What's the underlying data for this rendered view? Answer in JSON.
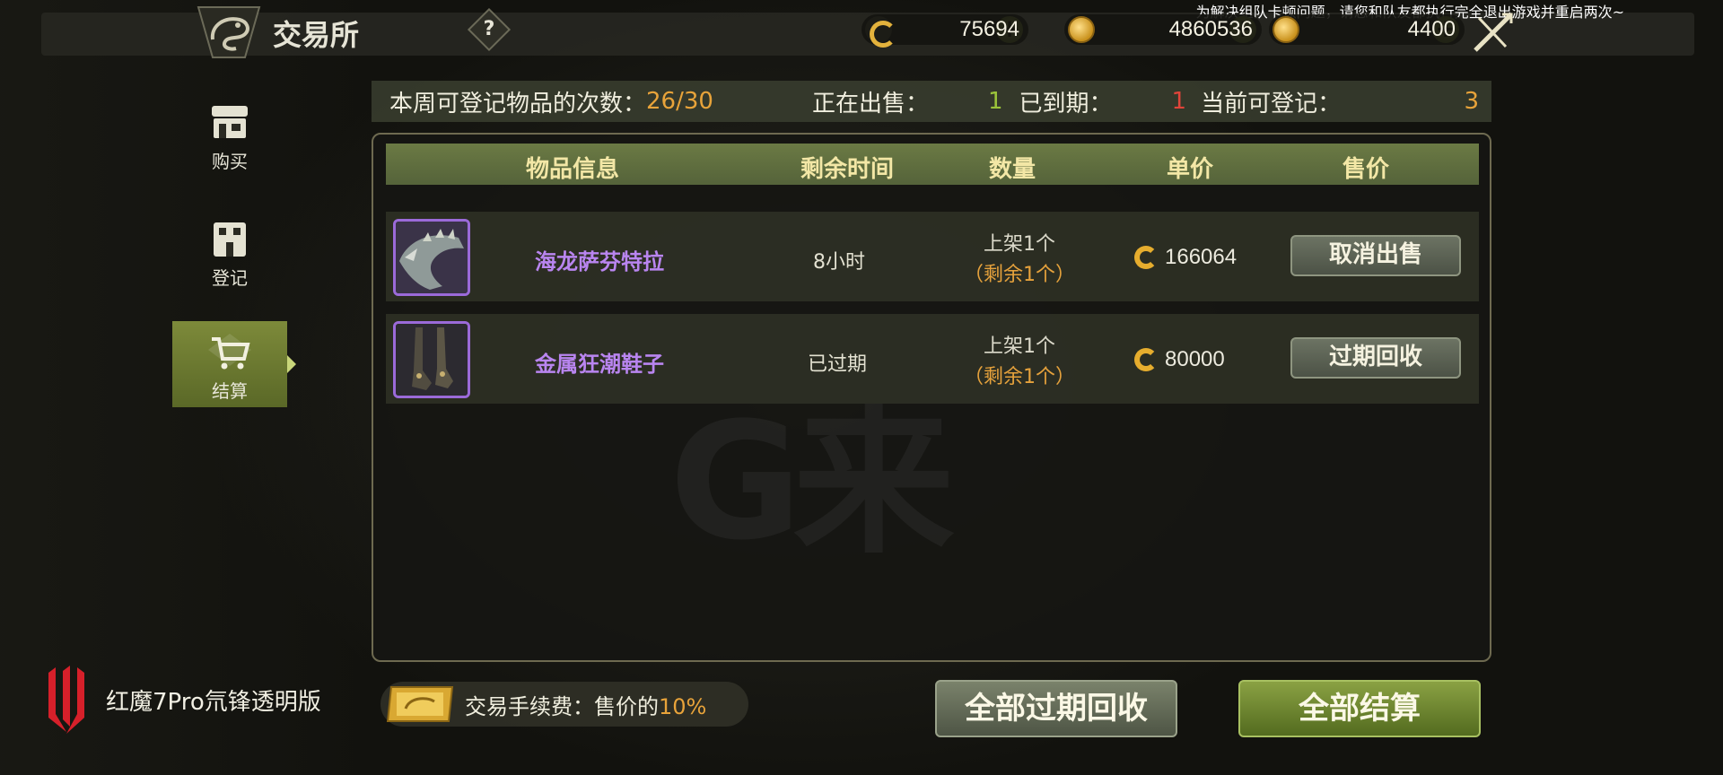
{
  "notice": "为解决组队卡顿问题，请您和队友都执行完全退出游戏并重启两次~",
  "header": {
    "title": "交易所",
    "help_label": "?",
    "currencies": [
      {
        "icon": "c-coin-icon",
        "value": "75694"
      },
      {
        "icon": "gold-coin-icon",
        "value": "4860536"
      },
      {
        "icon": "gold-token-icon",
        "value": "4400"
      }
    ],
    "plus_label": "+"
  },
  "sidebar": {
    "items": [
      {
        "label": "购买",
        "icon": "shop-icon",
        "active": false
      },
      {
        "label": "登记",
        "icon": "building-icon",
        "active": false
      },
      {
        "label": "结算",
        "icon": "cart-icon",
        "active": true
      }
    ]
  },
  "stats": {
    "weekly_label": "本周可登记物品的次数：",
    "weekly_value": "26/30",
    "selling_label": "正在出售：",
    "selling_value": "1",
    "expired_label": "已到期：",
    "expired_value": "1",
    "available_label": "当前可登记：",
    "available_value": "3"
  },
  "table": {
    "headers": [
      "物品信息",
      "剩余时间",
      "数量",
      "单价",
      "售价"
    ],
    "rows": [
      {
        "name": "海龙萨芬特拉",
        "time": "8小时",
        "qty_listed": "上架1个",
        "qty_remaining": "（剩余1个）",
        "price": "166064",
        "action": "取消出售"
      },
      {
        "name": "金属狂潮鞋子",
        "time": "已过期",
        "qty_listed": "上架1个",
        "qty_remaining": "（剩余1个）",
        "price": "80000",
        "action": "过期回收"
      }
    ]
  },
  "watermark": "G来",
  "footer": {
    "brand": "红魔7Pro氘锋透明版",
    "fee_label": "交易手续费：售价的",
    "fee_value": "10%",
    "btn_reclaim_all": "全部过期回收",
    "btn_settle_all": "全部结算"
  },
  "colors": {
    "accent_green": "#7d8a3a",
    "orange": "#e8a33a",
    "red": "#e0443a",
    "purple_name": "#b985f0"
  }
}
